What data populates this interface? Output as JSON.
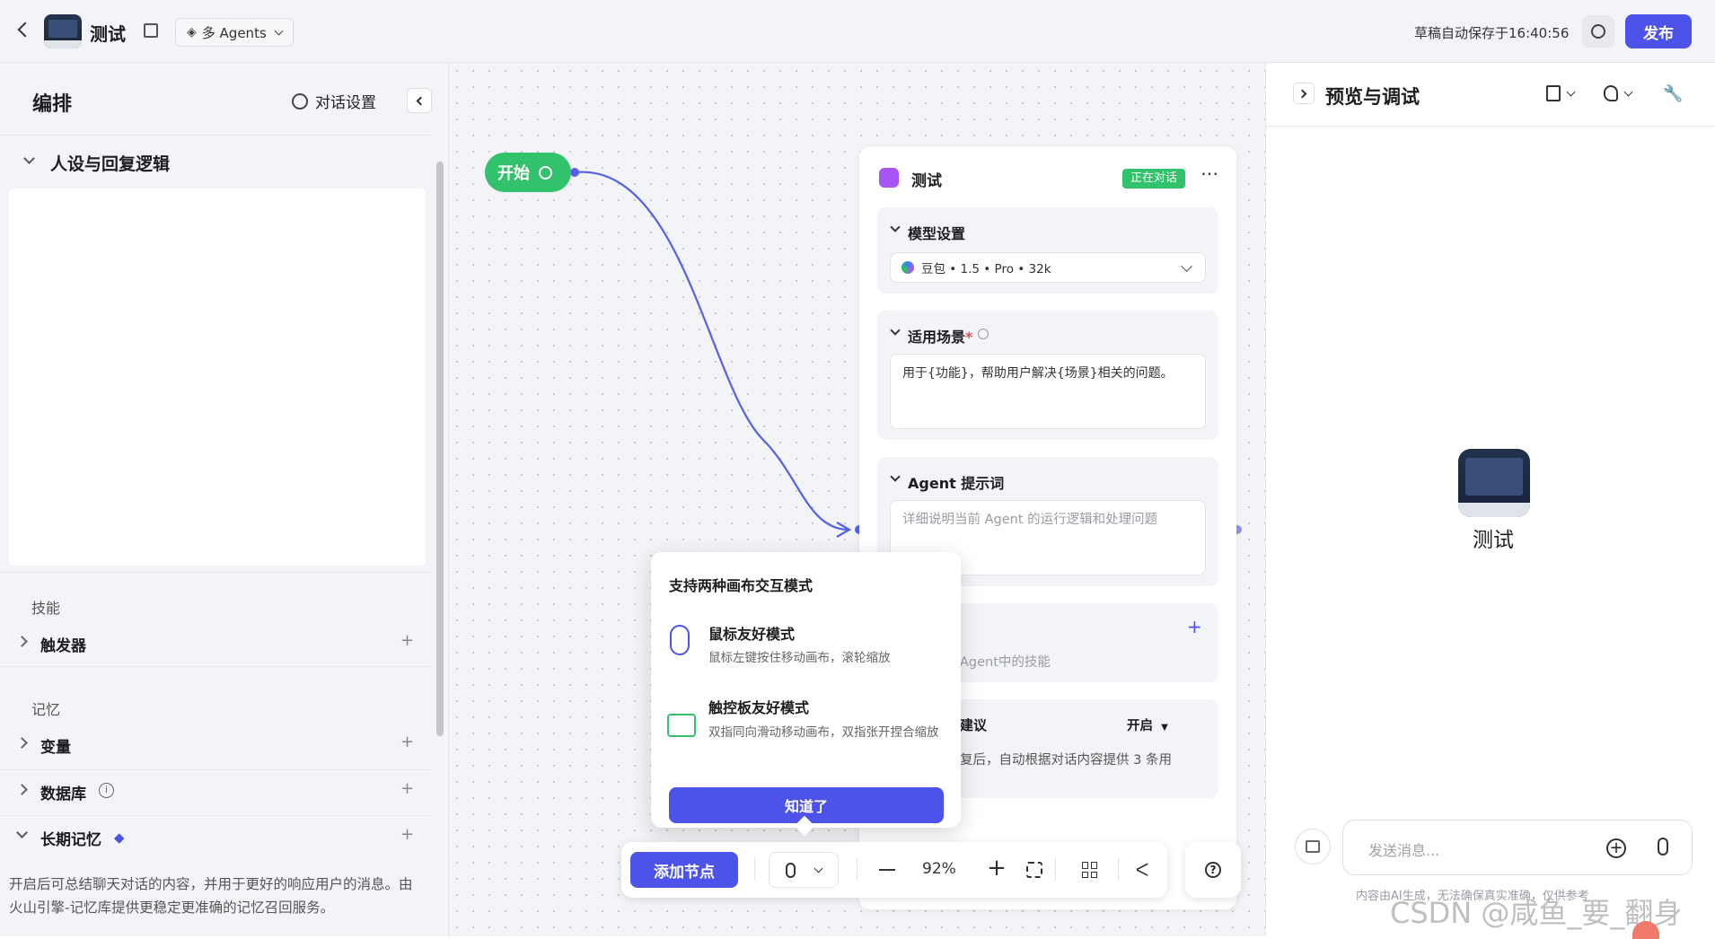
{
  "header": {
    "app_title": "测试",
    "agents_mode": "多 Agents",
    "autosave_text": "草稿自动保存于16:40:56",
    "publish_label": "发布"
  },
  "left": {
    "title": "编排",
    "dialog_settings": "对话设置",
    "persona_section": "人设与回复逻辑",
    "skills_group": "技能",
    "trigger": "触发器",
    "memory_group": "记忆",
    "variables": "变量",
    "database": "数据库",
    "long_memory": "长期记忆",
    "long_memory_desc": "开启后可总结聊天对话的内容，并用于更好的响应用户的消息。由火山引擎-记忆库提供更稳定更准确的记忆召回服务。"
  },
  "canvas": {
    "start_node": "开始",
    "agent_node": {
      "title": "测试",
      "status_badge": "正在对话",
      "model_section": "模型设置",
      "model_value": "豆包 • 1.5 • Pro • 32k",
      "scenario_section": "适用场景",
      "scenario_required_mark": "*",
      "scenario_text": "用于{功能}，帮助用户解决{场景}相关的问题。",
      "prompt_section": "Agent 提示词",
      "prompt_placeholder": "详细说明当前 Agent 的运行逻辑和处理问题",
      "skills_hint": "Agent中的技能",
      "suggest_section": "建议",
      "suggest_value": "开启",
      "suggest_desc": "复后，自动根据对话内容提供 3 条用"
    },
    "popup": {
      "title": "支持两种画布交互模式",
      "mouse_title": "鼠标友好模式",
      "mouse_desc": "鼠标左键按住移动画布，滚轮缩放",
      "trackpad_title": "触控板友好模式",
      "trackpad_desc": "双指同向滑动移动画布，双指张开捏合缩放",
      "ok_label": "知道了"
    },
    "toolbar": {
      "add_node": "添加节点",
      "zoom": "92%"
    }
  },
  "right": {
    "title": "预览与调试",
    "bot_name": "测试",
    "input_placeholder": "发送消息...",
    "disclaimer": "内容由AI生成，无法确保真实准确，仅供参考",
    "watermark": "CSDN @咸鱼_要_翻身"
  },
  "colors": {
    "primary": "#4d53e8",
    "start_green": "#32c26b",
    "badge_green": "#32c26b",
    "edge": "#5560e8"
  }
}
